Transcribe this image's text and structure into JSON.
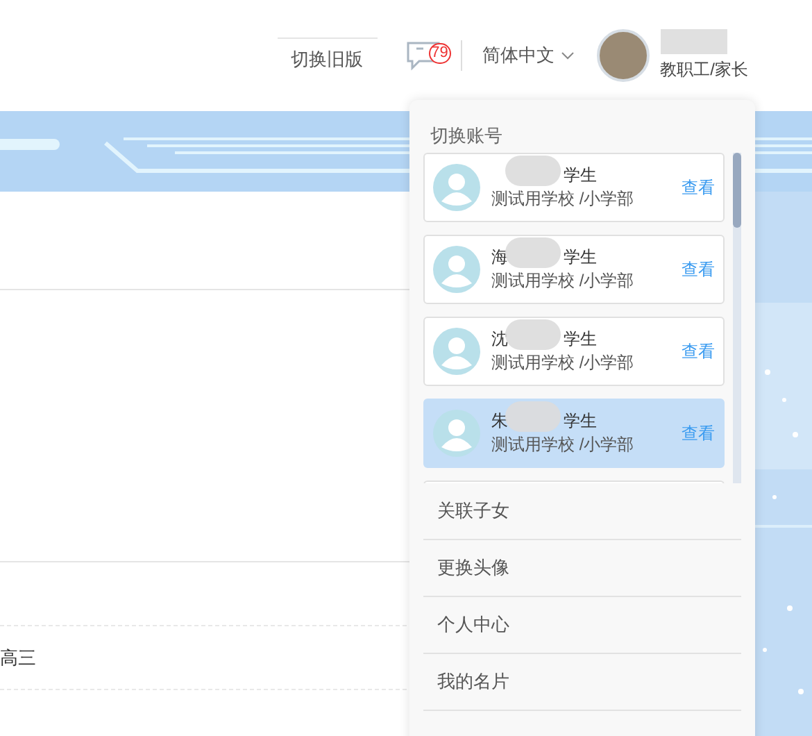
{
  "header": {
    "old_version_link": "切换旧版",
    "messages": {
      "count": "79"
    },
    "language": "简体中文",
    "user": {
      "role": "教职工/家长"
    }
  },
  "content": {
    "grade": "高三"
  },
  "account_menu": {
    "title": "切换账号",
    "accounts": [
      {
        "role": "学生",
        "school": "测试用学校 /小学部",
        "action": "查看",
        "selected": false
      },
      {
        "name": "海",
        "role": "学生",
        "school": "测试用学校 /小学部",
        "action": "查看",
        "selected": false
      },
      {
        "name": "沈",
        "role": "学生",
        "school": "测试用学校 /小学部",
        "action": "查看",
        "selected": false
      },
      {
        "name": "朱",
        "role": "学生",
        "school": "测试用学校 /小学部",
        "action": "查看",
        "selected": true
      }
    ],
    "items": [
      "关联子女",
      "更换头像",
      "个人中心",
      "我的名片"
    ]
  }
}
